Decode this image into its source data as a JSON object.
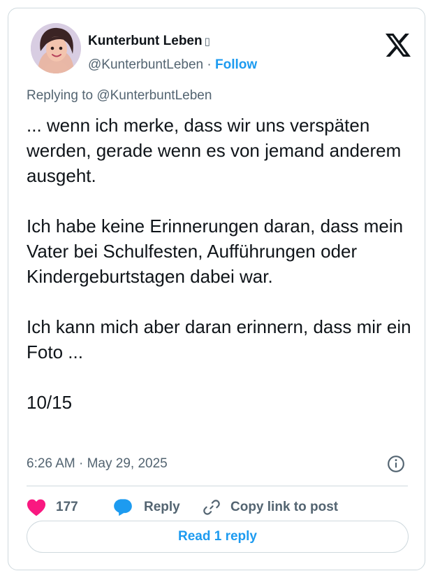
{
  "author": {
    "name": "Kunterbunt Leben",
    "badge": "▯",
    "handle": "@KunterbuntLeben",
    "separator": "·",
    "follow_label": "Follow"
  },
  "reply_context": {
    "prefix": "Replying to ",
    "handle": "@KunterbuntLeben"
  },
  "tweet": {
    "text": "... wenn ich merke, dass wir uns verspäten werden, gerade wenn es von jemand anderem ausgeht.\n\nIch habe keine Erinnerungen daran, dass mein Vater bei Schulfesten, Aufführungen oder Kindergeburtstagen dabei war.\n\nIch kann mich aber daran erinnern, dass mir ein Foto ...\n\n10/15",
    "timestamp": "6:26 AM · May 29, 2025"
  },
  "actions": {
    "like_count": "177",
    "reply_label": "Reply",
    "copy_label": "Copy link to post"
  },
  "read_replies_label": "Read 1 reply",
  "icons": {
    "logo": "x-logo-icon",
    "info": "info-icon",
    "like": "heart-icon",
    "reply": "speech-bubble-icon",
    "copy": "link-icon"
  },
  "colors": {
    "accent": "#1d9bf0",
    "like": "#f91880",
    "text": "#0f1419",
    "secondary": "#536471",
    "border": "#cfd9de"
  }
}
